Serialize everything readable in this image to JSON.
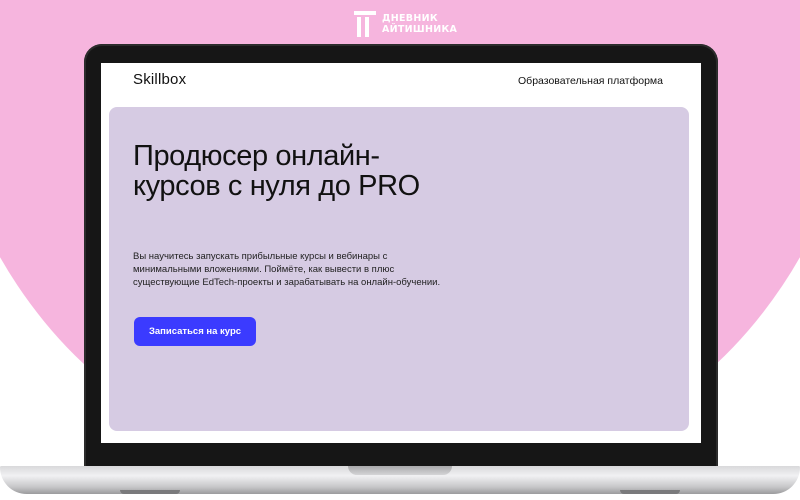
{
  "brand": {
    "line1": "ДНЕВНИК",
    "line2": "АЙТИШНИКА",
    "icon": "it-logo-icon"
  },
  "site": {
    "logo": "Skillbox",
    "tagline": "Образовательная платформа"
  },
  "hero": {
    "title": "Продюсер онлайн-курсов с нуля до PRO",
    "description": "Вы научитесь запускать прибыльные курсы и вебинары с минимальными вложениями. Поймёте, как вывести в плюс существующие EdTech-проекты и зарабатывать на онлайн-обучении.",
    "cta_label": "Записаться на курс"
  },
  "colors": {
    "background_pink": "#f6b5de",
    "hero_lavender": "#d6cbe3",
    "cta_blue": "#3b3bff"
  }
}
